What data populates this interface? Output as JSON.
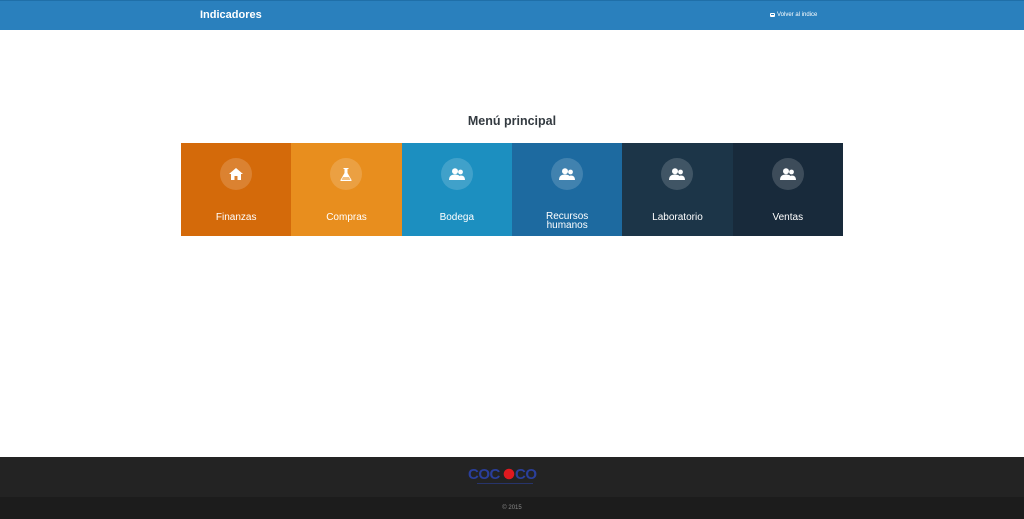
{
  "navbar": {
    "brand": "Indicadores",
    "back_link": "Volver al indice"
  },
  "main": {
    "title": "Menú principal",
    "tiles": [
      {
        "label": "Finanzas",
        "icon": "home-icon",
        "color": "#d46a0a"
      },
      {
        "label": "Compras",
        "icon": "flask-icon",
        "color": "#e88e1e"
      },
      {
        "label": "Bodega",
        "icon": "users-icon",
        "color": "#1c8fc0"
      },
      {
        "label_line1": "Recursos",
        "label_line2": "humanos",
        "icon": "users-icon",
        "color": "#1d6aa0"
      },
      {
        "label": "Laboratorio",
        "icon": "users-icon",
        "color": "#1c3548"
      },
      {
        "label": "Ventas",
        "icon": "users-icon",
        "color": "#182a3b"
      }
    ]
  },
  "footer": {
    "logo_text": "COCOCO",
    "copyright": "© 2015"
  }
}
